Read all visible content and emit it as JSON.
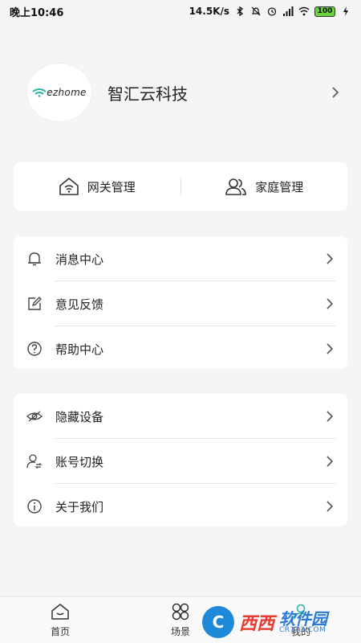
{
  "status_bar": {
    "time": "晚上10:46",
    "network_speed": "14.5K/s",
    "battery": "100"
  },
  "profile": {
    "logo_text": "ezhome",
    "name": "智汇云科技"
  },
  "management": {
    "gateway_label": "网关管理",
    "family_label": "家庭管理"
  },
  "menu_group_1": [
    {
      "label": "消息中心",
      "icon": "bell-icon"
    },
    {
      "label": "意见反馈",
      "icon": "edit-icon"
    },
    {
      "label": "帮助中心",
      "icon": "question-icon"
    }
  ],
  "menu_group_2": [
    {
      "label": "隐藏设备",
      "icon": "eye-hidden-icon"
    },
    {
      "label": "账号切换",
      "icon": "account-switch-icon"
    },
    {
      "label": "关于我们",
      "icon": "info-icon"
    }
  ],
  "tabbar": {
    "tabs": [
      {
        "label": "首页",
        "icon": "home-icon"
      },
      {
        "label": "场景",
        "icon": "scene-icon"
      },
      {
        "label": "我的",
        "icon": "profile-icon"
      }
    ]
  },
  "watermark": {
    "brand_cn": "西西",
    "brand_cn2": "软件园",
    "url": "CR173.COM"
  },
  "colors": {
    "background": "#f5f5f5",
    "card": "#ffffff",
    "text": "#222222",
    "wifi_logo": "#2bb5a6"
  }
}
